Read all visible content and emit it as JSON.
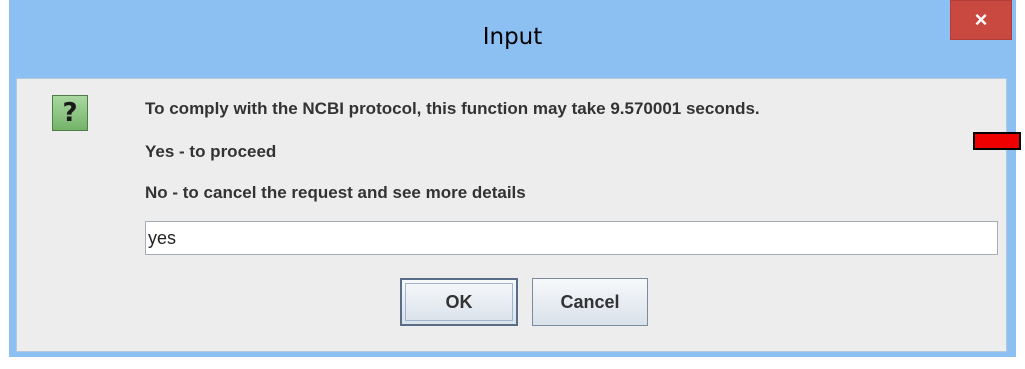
{
  "window": {
    "title": "Input",
    "close_glyph": "×"
  },
  "dialog": {
    "icon": "question-icon",
    "icon_glyph": "?",
    "messages": [
      "To comply with the NCBI protocol, this function may take 9.570001 seconds.",
      "Yes - to proceed",
      "No - to cancel the request and see more details"
    ],
    "input_value": "yes",
    "ok_label": "OK",
    "cancel_label": "Cancel"
  },
  "colors": {
    "titlebar": "#8cc0f2",
    "close_button": "#c9483f",
    "dialog_background": "#ededed",
    "icon_background": "#8fc585",
    "marker": "#ee0000"
  }
}
